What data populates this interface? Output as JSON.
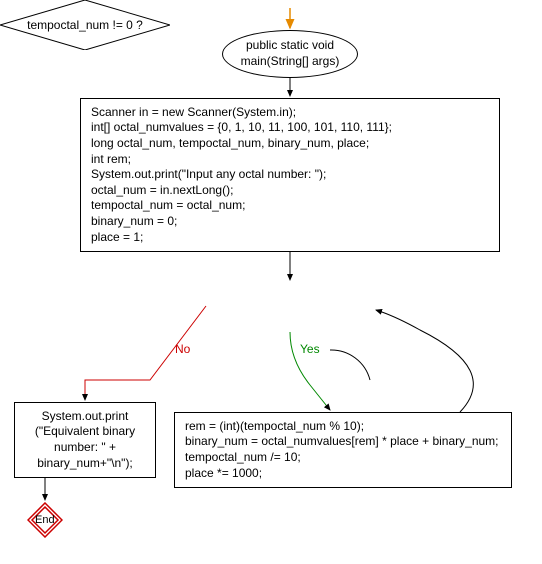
{
  "entry": {
    "label": "public static void\nmain(String[] args)"
  },
  "init_block": {
    "lines": [
      "Scanner in = new Scanner(System.in);",
      "int[] octal_numvalues = {0, 1, 10, 11, 100, 101, 110, 111};",
      "long octal_num, tempoctal_num, binary_num, place;",
      "int rem;",
      "System.out.print(\"Input any octal number: \");",
      "octal_num = in.nextLong();",
      "tempoctal_num = octal_num;",
      "binary_num = 0;",
      "place = 1;"
    ]
  },
  "decision": {
    "label": "tempoctal_num != 0 ?"
  },
  "loop_body": {
    "lines": [
      "rem = (int)(tempoctal_num % 10);",
      "binary_num = octal_numvalues[rem] * place + binary_num;",
      "tempoctal_num /= 10;",
      "place *= 1000;"
    ]
  },
  "output_block": {
    "lines": [
      "System.out.print",
      "(\"Equivalent binary",
      "number: \" +",
      "binary_num+\"\\n\");"
    ]
  },
  "end": {
    "label": "End"
  },
  "edges": {
    "no_label": "No",
    "yes_label": "Yes"
  }
}
